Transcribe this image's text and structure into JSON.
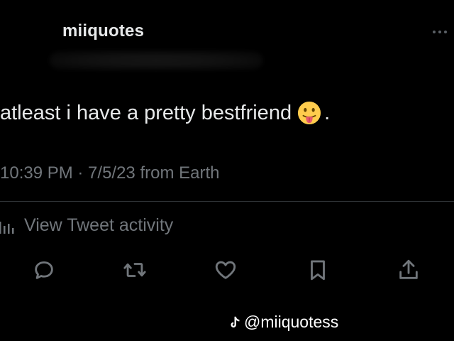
{
  "tweet": {
    "display_name": "miiquotes",
    "text": "atleast i have a pretty bestfriend",
    "text_suffix": ".",
    "emoji": "face-with-tongue",
    "timestamp": "10:39 PM · 7/5/23 from Earth",
    "activity_label": "View Tweet activity"
  },
  "actions": [
    {
      "name": "reply",
      "icon": "speech-bubble-icon"
    },
    {
      "name": "retweet",
      "icon": "retweet-icon"
    },
    {
      "name": "like",
      "icon": "heart-icon"
    },
    {
      "name": "bookmark",
      "icon": "bookmark-icon"
    },
    {
      "name": "share",
      "icon": "share-icon"
    }
  ],
  "watermark": {
    "handle": "@miiquotess",
    "icon": "tiktok-icon"
  },
  "colors": {
    "background": "#000000",
    "primary_text": "#e7e9ea",
    "secondary_text": "#71767b",
    "divider": "#2f3336"
  }
}
